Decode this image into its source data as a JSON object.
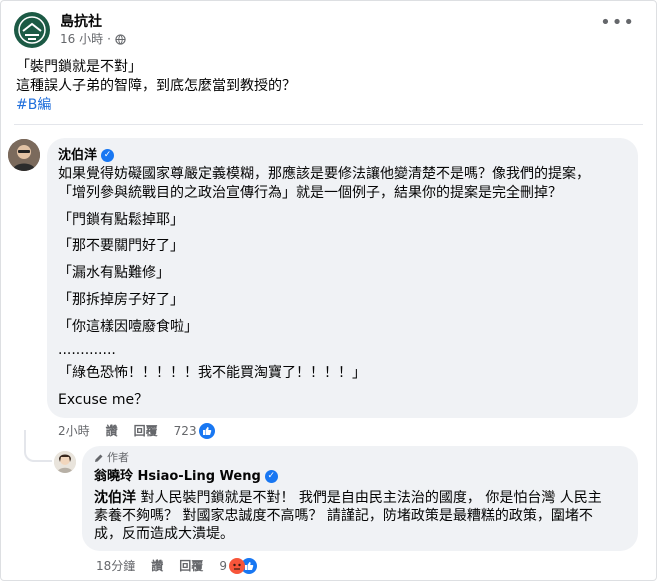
{
  "post": {
    "page_name": "島抗社",
    "time": "16 小時",
    "lines": [
      "「裝門鎖就是不對」",
      "這種誤人子弟的智障，到底怎麼當到教授的？"
    ],
    "hashtag": "#B編"
  },
  "comment1": {
    "author": "沈伯洋",
    "lines": [
      "如果覺得妨礙國家尊嚴定義模糊，那應該是要修法讓他變清楚不是嗎？像我們的提案，",
      "「增列參與統戰目的之政治宣傳行為」就是一個例子，結果你的提案是完全刪掉？",
      "「門鎖有點鬆掉耶」",
      "「那不要關門好了」",
      "「漏水有點難修」",
      "「那拆掉房子好了」",
      "「你這樣因噎廢食啦」",
      ".............",
      "「綠色恐怖！！！！！我不能買淘寶了！！！！」",
      "Excuse me？"
    ],
    "time": "2小時",
    "like_label": "讚",
    "reply_label": "回覆",
    "reactions": "723"
  },
  "reply1": {
    "author_tag": "作者",
    "author": "翁曉玲 Hsiao-Ling Weng",
    "mention": "沈伯洋",
    "lines": [
      " 對人民裝門鎖就是不對！ 我們是自由民主法治的國度， 你是怕台灣 人民主",
      "素養不夠嗎？ 對國家忠誠度不高嗎？ 請謹記，防堵政策是最糟糕的政策，圍堵不",
      "成，反而造成大潰堤。"
    ],
    "time": "18分鐘",
    "like_label": "讚",
    "reply_label": "回覆",
    "reactions": "9"
  },
  "colors": {
    "accent": "#1877f2",
    "hashtag": "#216fdb",
    "bubble": "#f0f2f5",
    "page_logo": "#1c5a45",
    "angry": "#f7553a"
  },
  "icons": {
    "privacy": "globe-icon",
    "more": "more-options-icon",
    "like": "like-thumb-icon",
    "angry": "angry-face-icon",
    "author_tag": "pencil-icon"
  }
}
